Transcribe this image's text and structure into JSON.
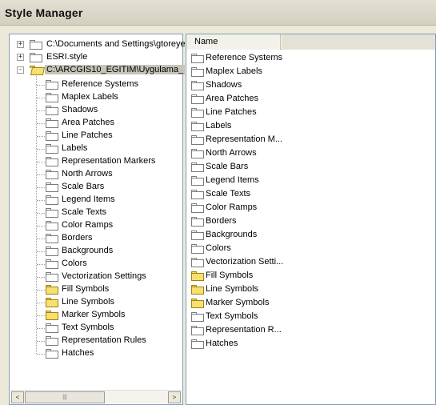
{
  "window": {
    "title": "Style Manager"
  },
  "tree": {
    "roots": [
      {
        "label": "C:\\Documents and Settings\\gtoreye",
        "expander": "+",
        "icon": "folder-icon"
      },
      {
        "label": "ESRI.style",
        "expander": "+",
        "icon": "folder-icon"
      },
      {
        "label": "C:\\ARCGIS10_EGITIM\\Uygulama_",
        "expander": "-",
        "icon": "open-folder-icon",
        "selected": true
      }
    ],
    "children": [
      {
        "label": "Reference Systems",
        "filled": false
      },
      {
        "label": "Maplex Labels",
        "filled": false
      },
      {
        "label": "Shadows",
        "filled": false
      },
      {
        "label": "Area Patches",
        "filled": false
      },
      {
        "label": "Line Patches",
        "filled": false
      },
      {
        "label": "Labels",
        "filled": false
      },
      {
        "label": "Representation Markers",
        "filled": false
      },
      {
        "label": "North Arrows",
        "filled": false
      },
      {
        "label": "Scale Bars",
        "filled": false
      },
      {
        "label": "Legend Items",
        "filled": false
      },
      {
        "label": "Scale Texts",
        "filled": false
      },
      {
        "label": "Color Ramps",
        "filled": false
      },
      {
        "label": "Borders",
        "filled": false
      },
      {
        "label": "Backgrounds",
        "filled": false
      },
      {
        "label": "Colors",
        "filled": false
      },
      {
        "label": "Vectorization Settings",
        "filled": false
      },
      {
        "label": "Fill Symbols",
        "filled": true
      },
      {
        "label": "Line Symbols",
        "filled": true
      },
      {
        "label": "Marker Symbols",
        "filled": true
      },
      {
        "label": "Text Symbols",
        "filled": false
      },
      {
        "label": "Representation Rules",
        "filled": false
      },
      {
        "label": "Hatches",
        "filled": false
      }
    ],
    "scroll": {
      "left_arrow": "<",
      "right_arrow": ">",
      "thumb_grip": "|||"
    }
  },
  "list": {
    "header": {
      "name_col": "Name"
    },
    "items": [
      {
        "label": "Reference Systems",
        "filled": false
      },
      {
        "label": "Maplex Labels",
        "filled": false
      },
      {
        "label": "Shadows",
        "filled": false
      },
      {
        "label": "Area Patches",
        "filled": false
      },
      {
        "label": "Line Patches",
        "filled": false
      },
      {
        "label": "Labels",
        "filled": false
      },
      {
        "label": "Representation M...",
        "filled": false
      },
      {
        "label": "North Arrows",
        "filled": false
      },
      {
        "label": "Scale Bars",
        "filled": false
      },
      {
        "label": "Legend Items",
        "filled": false
      },
      {
        "label": "Scale Texts",
        "filled": false
      },
      {
        "label": "Color Ramps",
        "filled": false
      },
      {
        "label": "Borders",
        "filled": false
      },
      {
        "label": "Backgrounds",
        "filled": false
      },
      {
        "label": "Colors",
        "filled": false
      },
      {
        "label": "Vectorization Setti...",
        "filled": false
      },
      {
        "label": "Fill Symbols",
        "filled": true
      },
      {
        "label": "Line Symbols",
        "filled": true
      },
      {
        "label": "Marker Symbols",
        "filled": true
      },
      {
        "label": "Text Symbols",
        "filled": false
      },
      {
        "label": "Representation R...",
        "filled": false
      },
      {
        "label": "Hatches",
        "filled": false
      }
    ]
  },
  "colors": {
    "panel_border": "#7f9db9",
    "folder_yellow": "#f8e070",
    "selection": "#c6c3b8"
  }
}
